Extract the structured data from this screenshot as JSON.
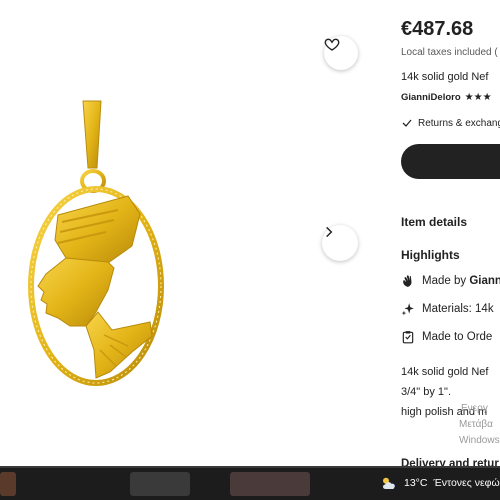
{
  "product": {
    "price": "€487.68",
    "tax_note": "Local taxes included (",
    "title": "14k solid gold Nef",
    "shop_name": "GianniDeloro",
    "stars": "★★★",
    "returns": "Returns & exchang",
    "gold_color": "#e3b417"
  },
  "sections": {
    "item_details": "Item details",
    "highlights": "Highlights",
    "highlight_items": [
      {
        "icon": "hand-wave-icon",
        "prefix": "Made by ",
        "bold": "Giann"
      },
      {
        "icon": "sparkle-icon",
        "prefix": "Materials: 14k",
        "bold": ""
      },
      {
        "icon": "clipboard-icon",
        "prefix": "Made to Orde",
        "bold": ""
      }
    ],
    "description_lines": [
      "14k solid gold Nef",
      "3/4\" by 1\".",
      "high polish and m"
    ],
    "delivery": "Delivery and retur"
  },
  "activation_watermark": [
    "Ενεργ",
    "Μετάβα",
    "Windows"
  ],
  "taskbar": {
    "temperature": "13°C",
    "weather_text": "Έντονες νεφώσ",
    "weather_icon": "cloud-sun-icon"
  },
  "icons": {
    "favorite": "heart-icon",
    "next": "chevron-right-icon",
    "returns": "checkmark-icon"
  }
}
